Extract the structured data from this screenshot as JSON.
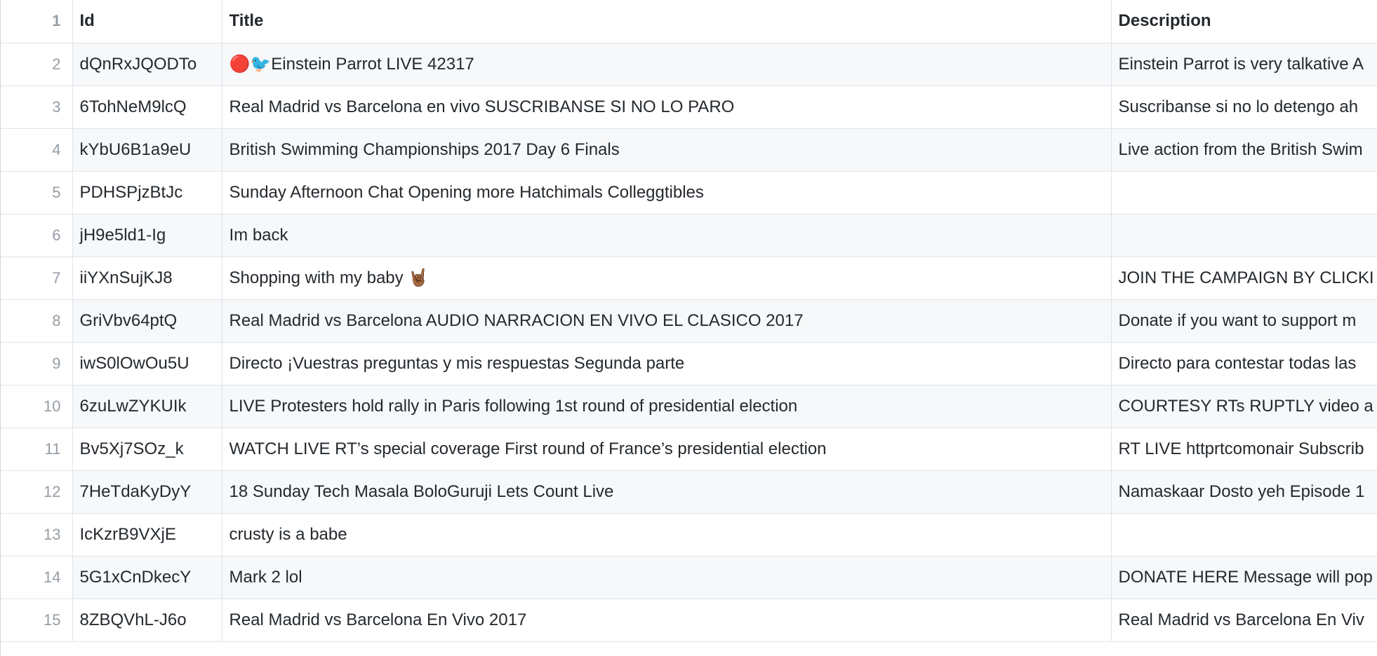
{
  "table": {
    "header": {
      "row_number": "1",
      "columns": [
        "Id",
        "Title",
        "Description"
      ]
    },
    "rows": [
      {
        "n": "2",
        "id": "dQnRxJQODTo",
        "title": "🔴🐦Einstein Parrot LIVE 42317",
        "description": "Einstein Parrot is very talkative A"
      },
      {
        "n": "3",
        "id": "6TohNeM9lcQ",
        "title": "Real Madrid vs Barcelona en vivo SUSCRIBANSE SI NO LO PARO",
        "description": "Suscribanse si no lo detengo ah"
      },
      {
        "n": "4",
        "id": "kYbU6B1a9eU",
        "title": "British Swimming Championships 2017 Day 6 Finals",
        "description": "Live action from the British Swim"
      },
      {
        "n": "5",
        "id": "PDHSPjzBtJc",
        "title": "Sunday Afternoon Chat Opening more Hatchimals Colleggtibles",
        "description": ""
      },
      {
        "n": "6",
        "id": "jH9e5ld1-Ig",
        "title": "Im back",
        "description": ""
      },
      {
        "n": "7",
        "id": "iiYXnSujKJ8",
        "title": "Shopping with my baby 🤘🏾",
        "description": "JOIN THE CAMPAIGN BY CLICKI"
      },
      {
        "n": "8",
        "id": "GriVbv64ptQ",
        "title": "Real Madrid vs Barcelona AUDIO NARRACION EN VIVO EL CLASICO 2017",
        "description": "Donate if you want to support m"
      },
      {
        "n": "9",
        "id": "iwS0lOwOu5U",
        "title": "Directo ¡Vuestras preguntas y mis respuestas Segunda parte",
        "description": "Directo para contestar todas las"
      },
      {
        "n": "10",
        "id": "6zuLwZYKUIk",
        "title": "LIVE Protesters hold rally in Paris following 1st round of presidential election",
        "description": "COURTESY RTs RUPTLY video a"
      },
      {
        "n": "11",
        "id": "Bv5Xj7SOz_k",
        "title": "WATCH LIVE RT’s special coverage First round of France’s presidential election",
        "description": "RT LIVE httprtcomonair Subscrib"
      },
      {
        "n": "12",
        "id": "7HeTdaKyDyY",
        "title": "18 Sunday Tech Masala BoloGuruji Lets Count Live",
        "description": "Namaskaar Dosto yeh Episode 1"
      },
      {
        "n": "13",
        "id": "IcKzrB9VXjE",
        "title": "crusty is a babe",
        "description": ""
      },
      {
        "n": "14",
        "id": "5G1xCnDkecY",
        "title": "Mark 2 lol",
        "description": "DONATE HERE Message will pop"
      },
      {
        "n": "15",
        "id": "8ZBQVhL-J6o",
        "title": "Real Madrid vs Barcelona En Vivo 2017",
        "description": "Real Madrid vs Barcelona En Viv"
      }
    ]
  }
}
